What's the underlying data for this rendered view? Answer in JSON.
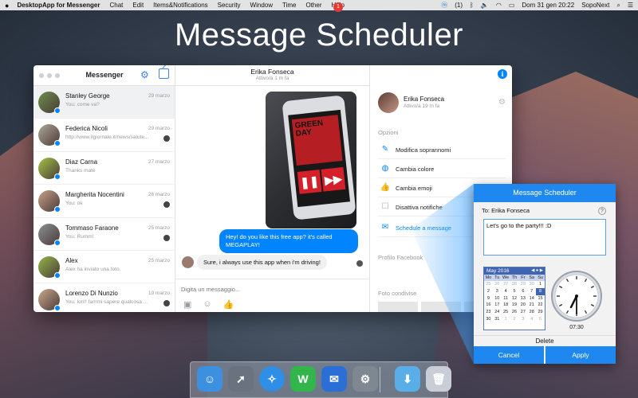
{
  "menubar": {
    "app_name": "DesktopApp for Messenger",
    "items": [
      "Chat",
      "Edit",
      "Items&Notifications",
      "Security",
      "Window",
      "Time",
      "Other",
      "Help"
    ],
    "notif_count": "(1)",
    "clock": "Dom 31 gen  20:22",
    "user": "SopoNext"
  },
  "headline": "Message Scheduler",
  "sidebar": {
    "title": "Messenger",
    "conversations": [
      {
        "name": "Stanley George",
        "preview": "You: come va?",
        "date": "29 marzo",
        "color": "#6c8f4e"
      },
      {
        "name": "Federica Nicoli",
        "preview": "http://www.ilgiornale.it/news/salute...",
        "date": "29 marzo",
        "color": "#b0a79a"
      },
      {
        "name": "Diaz Carna",
        "preview": "Thanks mate",
        "date": "27 marzo",
        "color": "#a4c44a"
      },
      {
        "name": "Margherita Nocentini",
        "preview": "You: ok",
        "date": "26 marzo",
        "color": "#c7a08a"
      },
      {
        "name": "Tommaso Faraone",
        "preview": "You: Rumm!",
        "date": "25 marzo",
        "color": "#8a8f96"
      },
      {
        "name": "Alex",
        "preview": "Alex ha inviato una foto.",
        "date": "25 marzo",
        "color": "#95b84a"
      },
      {
        "name": "Lorenzo Di Nunzio",
        "preview": "You: lori!! fammi sapere qualcosa ...",
        "date": "19 marzo",
        "color": "#c9a88c"
      }
    ]
  },
  "chat": {
    "contact": "Erika Fonseca",
    "status": "Attivo/a 1 m fa",
    "album_text": "GREEN DAY",
    "message_out": "Hey! do you like this free app? it's called MEGAPLAY!",
    "message_in": "Sure, i always use this app when i'm driving!",
    "composer_placeholder": "Digita un messaggio..."
  },
  "details": {
    "name": "Erika Fonseca",
    "status": "Attivo/a 19 m fa",
    "options_label": "Opzioni",
    "options": [
      "Modifica soprannomi",
      "Cambia colore",
      "Cambia emoji",
      "Disattiva notifiche",
      "Schedule a message"
    ],
    "profile_label": "Profilo Facebook",
    "shared_label": "Foto condivise"
  },
  "scheduler": {
    "title": "Message Scheduler",
    "to": "To: Erika Fonseca",
    "help": "?",
    "message": "Let's go to the party!!! :D",
    "month": "May 2016",
    "weekdays": [
      "Mo",
      "Tu",
      "We",
      "Th",
      "Fr",
      "Sa",
      "Su"
    ],
    "days": [
      {
        "n": "25",
        "m": true
      },
      {
        "n": "26",
        "m": true
      },
      {
        "n": "27",
        "m": true
      },
      {
        "n": "28",
        "m": true
      },
      {
        "n": "29",
        "m": true
      },
      {
        "n": "30",
        "m": true
      },
      {
        "n": "1"
      },
      {
        "n": "2"
      },
      {
        "n": "3"
      },
      {
        "n": "4"
      },
      {
        "n": "5"
      },
      {
        "n": "6"
      },
      {
        "n": "7"
      },
      {
        "n": "8",
        "s": true
      },
      {
        "n": "9"
      },
      {
        "n": "10"
      },
      {
        "n": "11"
      },
      {
        "n": "12"
      },
      {
        "n": "13"
      },
      {
        "n": "14"
      },
      {
        "n": "15"
      },
      {
        "n": "16"
      },
      {
        "n": "17"
      },
      {
        "n": "18"
      },
      {
        "n": "19"
      },
      {
        "n": "20"
      },
      {
        "n": "21"
      },
      {
        "n": "22"
      },
      {
        "n": "23"
      },
      {
        "n": "24"
      },
      {
        "n": "25"
      },
      {
        "n": "26"
      },
      {
        "n": "27"
      },
      {
        "n": "28"
      },
      {
        "n": "29"
      },
      {
        "n": "30"
      },
      {
        "n": "31"
      },
      {
        "n": "1",
        "m": true
      },
      {
        "n": "2",
        "m": true
      },
      {
        "n": "3",
        "m": true
      },
      {
        "n": "4",
        "m": true
      },
      {
        "n": "5",
        "m": true
      }
    ],
    "time": "07:30",
    "delete": "Delete",
    "cancel": "Cancel",
    "apply": "Apply"
  },
  "dock": {
    "badge": "1",
    "icons": [
      {
        "name": "finder-icon",
        "color": "#3d8fe0",
        "glyph": "☺"
      },
      {
        "name": "launchpad-icon",
        "color": "#6a7280",
        "glyph": "➚"
      },
      {
        "name": "safari-icon",
        "color": "#2f8fe6",
        "glyph": "✧"
      },
      {
        "name": "whatsapp-icon",
        "color": "#32b54a",
        "glyph": "W"
      },
      {
        "name": "messenger-app-icon",
        "color": "#2b6fd6",
        "glyph": "✉"
      },
      {
        "name": "system-preferences-icon",
        "color": "#7f8790",
        "glyph": "⚙"
      },
      {
        "name": "downloads-folder-icon",
        "color": "#5aaee8",
        "glyph": "⬇"
      },
      {
        "name": "trash-icon",
        "color": "#c9ced6",
        "glyph": "🗑"
      }
    ]
  }
}
